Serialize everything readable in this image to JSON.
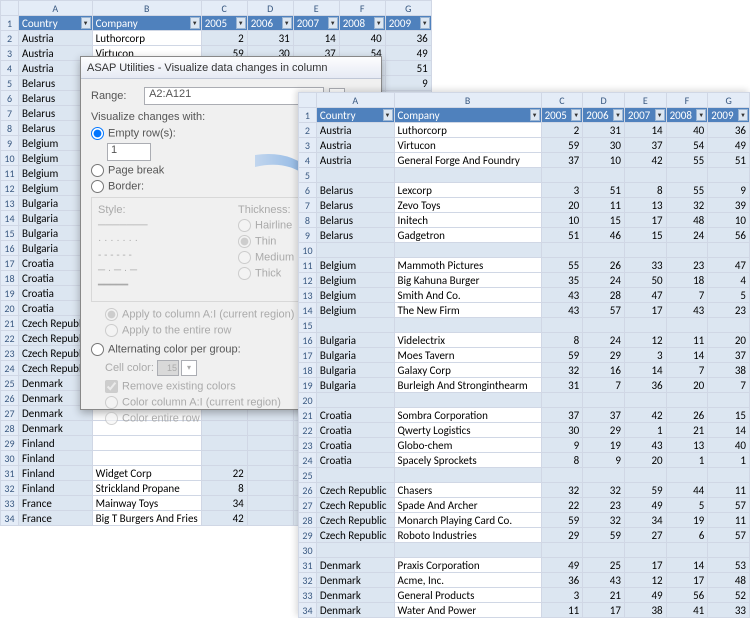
{
  "colHeaders": [
    "A",
    "B",
    "C",
    "D",
    "E",
    "F",
    "G"
  ],
  "tableHeaders": [
    "Country",
    "Company",
    "2005",
    "2006",
    "2007",
    "2008",
    "2009"
  ],
  "bg": {
    "rows": [
      {
        "n": 1,
        "hdr": true
      },
      {
        "n": 2,
        "c": "Austria",
        "co": "Luthorcorp",
        "v": [
          "2",
          "31",
          "14",
          "40",
          "36"
        ]
      },
      {
        "n": 3,
        "c": "Austria",
        "co": "Virtucon",
        "v": [
          "59",
          "30",
          "37",
          "54",
          "49"
        ]
      },
      {
        "n": 4,
        "c": "Austria",
        "co": "",
        "v": [
          "",
          "",
          "",
          "",
          "51"
        ]
      },
      {
        "n": 5,
        "c": "Belarus",
        "co": "",
        "v": [
          "",
          "",
          "",
          "",
          "9"
        ]
      },
      {
        "n": 6,
        "c": "Belarus",
        "co": "",
        "v": [
          "",
          "",
          "",
          "",
          ""
        ]
      },
      {
        "n": 7,
        "c": "Belarus",
        "co": "",
        "v": [
          "",
          "",
          "",
          "",
          ""
        ]
      },
      {
        "n": 8,
        "c": "Belarus",
        "co": "",
        "v": [
          "",
          "",
          "",
          "",
          ""
        ]
      },
      {
        "n": 9,
        "c": "Belgium",
        "co": "",
        "v": [
          "",
          "",
          "",
          "",
          ""
        ]
      },
      {
        "n": 10,
        "c": "Belgium",
        "co": "",
        "v": [
          "",
          "",
          "",
          "",
          ""
        ]
      },
      {
        "n": 11,
        "c": "Belgium",
        "co": "",
        "v": [
          "",
          "",
          "",
          "",
          ""
        ]
      },
      {
        "n": 12,
        "c": "Belgium",
        "co": "",
        "v": [
          "",
          "",
          "",
          "",
          ""
        ]
      },
      {
        "n": 13,
        "c": "Bulgaria",
        "co": "",
        "v": [
          "",
          "",
          "",
          "",
          ""
        ]
      },
      {
        "n": 14,
        "c": "Bulgaria",
        "co": "",
        "v": [
          "",
          "",
          "",
          "",
          ""
        ]
      },
      {
        "n": 15,
        "c": "Bulgaria",
        "co": "",
        "v": [
          "",
          "",
          "",
          "",
          ""
        ]
      },
      {
        "n": 16,
        "c": "Bulgaria",
        "co": "",
        "v": [
          "",
          "",
          "",
          "",
          ""
        ]
      },
      {
        "n": 17,
        "c": "Croatia",
        "co": "",
        "v": [
          "",
          "",
          "",
          "",
          ""
        ]
      },
      {
        "n": 18,
        "c": "Croatia",
        "co": "",
        "v": [
          "",
          "",
          "",
          "",
          ""
        ]
      },
      {
        "n": 19,
        "c": "Croatia",
        "co": "",
        "v": [
          "",
          "",
          "",
          "",
          ""
        ]
      },
      {
        "n": 20,
        "c": "Croatia",
        "co": "",
        "v": [
          "",
          "",
          "",
          "",
          ""
        ]
      },
      {
        "n": 21,
        "c": "Czech Republic",
        "co": "",
        "v": [
          "",
          "",
          "",
          "",
          ""
        ]
      },
      {
        "n": 22,
        "c": "Czech Republic",
        "co": "",
        "v": [
          "",
          "",
          "",
          "",
          ""
        ]
      },
      {
        "n": 23,
        "c": "Czech Republic",
        "co": "",
        "v": [
          "",
          "",
          "",
          "",
          ""
        ]
      },
      {
        "n": 24,
        "c": "Czech Republic",
        "co": "",
        "v": [
          "",
          "",
          "",
          "",
          ""
        ]
      },
      {
        "n": 25,
        "c": "Denmark",
        "co": "",
        "v": [
          "",
          "",
          "",
          "",
          ""
        ]
      },
      {
        "n": 26,
        "c": "Denmark",
        "co": "",
        "v": [
          "",
          "",
          "",
          "",
          ""
        ]
      },
      {
        "n": 27,
        "c": "Denmark",
        "co": "",
        "v": [
          "",
          "",
          "",
          "",
          ""
        ]
      },
      {
        "n": 28,
        "c": "Denmark",
        "co": "",
        "v": [
          "",
          "",
          "",
          "",
          ""
        ]
      },
      {
        "n": 29,
        "c": "Finland",
        "co": "",
        "v": [
          "",
          "",
          "",
          "",
          ""
        ]
      },
      {
        "n": 30,
        "c": "Finland",
        "co": "",
        "v": [
          "",
          "",
          "",
          "",
          ""
        ]
      },
      {
        "n": 31,
        "c": "Finland",
        "co": "Widget Corp",
        "v": [
          "22",
          "",
          "",
          "",
          ""
        ]
      },
      {
        "n": 32,
        "c": "Finland",
        "co": "Strickland Propane",
        "v": [
          "8",
          "",
          "",
          "",
          ""
        ]
      },
      {
        "n": 33,
        "c": "France",
        "co": "Mainway Toys",
        "v": [
          "34",
          "",
          "",
          "",
          ""
        ]
      },
      {
        "n": 34,
        "c": "France",
        "co": "Big T Burgers And Fries",
        "v": [
          "42",
          "",
          "",
          "",
          ""
        ]
      }
    ]
  },
  "fg": {
    "rows": [
      {
        "n": 1,
        "hdr": true
      },
      {
        "n": 2,
        "c": "Austria",
        "co": "Luthorcorp",
        "v": [
          "2",
          "31",
          "14",
          "40",
          "36"
        ]
      },
      {
        "n": 3,
        "c": "Austria",
        "co": "Virtucon",
        "v": [
          "59",
          "30",
          "37",
          "54",
          "49"
        ]
      },
      {
        "n": 4,
        "c": "Austria",
        "co": "General Forge And Foundry",
        "v": [
          "37",
          "10",
          "42",
          "55",
          "51"
        ]
      },
      {
        "n": 5,
        "empty": true
      },
      {
        "n": 6,
        "c": "Belarus",
        "co": "Lexcorp",
        "v": [
          "3",
          "51",
          "8",
          "55",
          "9"
        ]
      },
      {
        "n": 7,
        "c": "Belarus",
        "co": "Zevo Toys",
        "v": [
          "20",
          "11",
          "13",
          "32",
          "39"
        ]
      },
      {
        "n": 8,
        "c": "Belarus",
        "co": "Initech",
        "v": [
          "10",
          "15",
          "17",
          "48",
          "10"
        ]
      },
      {
        "n": 9,
        "c": "Belarus",
        "co": "Gadgetron",
        "v": [
          "51",
          "46",
          "15",
          "24",
          "56"
        ]
      },
      {
        "n": 10,
        "empty": true
      },
      {
        "n": 11,
        "c": "Belgium",
        "co": "Mammoth Pictures",
        "v": [
          "55",
          "26",
          "33",
          "23",
          "47"
        ]
      },
      {
        "n": 12,
        "c": "Belgium",
        "co": "Big Kahuna Burger",
        "v": [
          "35",
          "24",
          "50",
          "18",
          "4"
        ]
      },
      {
        "n": 13,
        "c": "Belgium",
        "co": "Smith And Co.",
        "v": [
          "43",
          "28",
          "47",
          "7",
          "5"
        ]
      },
      {
        "n": 14,
        "c": "Belgium",
        "co": "The New Firm",
        "v": [
          "43",
          "57",
          "17",
          "43",
          "23"
        ]
      },
      {
        "n": 15,
        "empty": true
      },
      {
        "n": 16,
        "c": "Bulgaria",
        "co": "Videlectrix",
        "v": [
          "8",
          "24",
          "12",
          "11",
          "20"
        ]
      },
      {
        "n": 17,
        "c": "Bulgaria",
        "co": "Moes Tavern",
        "v": [
          "59",
          "29",
          "3",
          "14",
          "37"
        ]
      },
      {
        "n": 18,
        "c": "Bulgaria",
        "co": "Galaxy Corp",
        "v": [
          "32",
          "16",
          "14",
          "7",
          "38"
        ]
      },
      {
        "n": 19,
        "c": "Bulgaria",
        "co": "Burleigh And Stronginthearm",
        "v": [
          "31",
          "7",
          "36",
          "20",
          "7"
        ]
      },
      {
        "n": 20,
        "empty": true
      },
      {
        "n": 21,
        "c": "Croatia",
        "co": "Sombra Corporation",
        "v": [
          "37",
          "37",
          "42",
          "26",
          "15"
        ]
      },
      {
        "n": 22,
        "c": "Croatia",
        "co": "Qwerty Logistics",
        "v": [
          "30",
          "29",
          "1",
          "21",
          "14"
        ]
      },
      {
        "n": 23,
        "c": "Croatia",
        "co": "Globo-chem",
        "v": [
          "9",
          "19",
          "43",
          "13",
          "40"
        ]
      },
      {
        "n": 24,
        "c": "Croatia",
        "co": "Spacely Sprockets",
        "v": [
          "8",
          "9",
          "20",
          "1",
          "1"
        ]
      },
      {
        "n": 25,
        "empty": true
      },
      {
        "n": 26,
        "c": "Czech Republic",
        "co": "Chasers",
        "v": [
          "32",
          "32",
          "59",
          "44",
          "11"
        ]
      },
      {
        "n": 27,
        "c": "Czech Republic",
        "co": "Spade And Archer",
        "v": [
          "22",
          "23",
          "49",
          "5",
          "57"
        ]
      },
      {
        "n": 28,
        "c": "Czech Republic",
        "co": "Monarch Playing Card Co.",
        "v": [
          "59",
          "32",
          "34",
          "19",
          "11"
        ]
      },
      {
        "n": 29,
        "c": "Czech Republic",
        "co": "Roboto Industries",
        "v": [
          "29",
          "59",
          "27",
          "6",
          "57"
        ]
      },
      {
        "n": 30,
        "empty": true
      },
      {
        "n": 31,
        "c": "Denmark",
        "co": "Praxis Corporation",
        "v": [
          "49",
          "25",
          "17",
          "14",
          "53"
        ]
      },
      {
        "n": 32,
        "c": "Denmark",
        "co": "Acme, Inc.",
        "v": [
          "36",
          "43",
          "12",
          "17",
          "48"
        ]
      },
      {
        "n": 33,
        "c": "Denmark",
        "co": "General Products",
        "v": [
          "3",
          "21",
          "49",
          "56",
          "52"
        ]
      },
      {
        "n": 34,
        "c": "Denmark",
        "co": "Water And Power",
        "v": [
          "11",
          "17",
          "38",
          "41",
          "33"
        ]
      }
    ]
  },
  "dialog": {
    "title": "ASAP Utilities - Visualize data changes in column",
    "rangeLabel": "Range:",
    "rangeValue": "A2:A121",
    "visualizeLabel": "Visualize changes with:",
    "optEmpty": "Empty row(s):",
    "emptyCount": "1",
    "optPageBreak": "Page break",
    "optBorder": "Border:",
    "styleLabel": "Style:",
    "thicknessLabel": "Thickness:",
    "thick": {
      "hairline": "Hairline",
      "thin": "Thin",
      "medium": "Medium",
      "thickv": "Thick"
    },
    "applyColA": "Apply to column A:I (current region)",
    "applyRow": "Apply to the entire row",
    "optAlt": "Alternating color per group:",
    "cellColorLabel": "Cell color:",
    "cellColorVal": "15",
    "removeColors": "Remove existing colors",
    "colorColA": "Color column A:I (current region)",
    "colorRow": "Color entire row"
  }
}
